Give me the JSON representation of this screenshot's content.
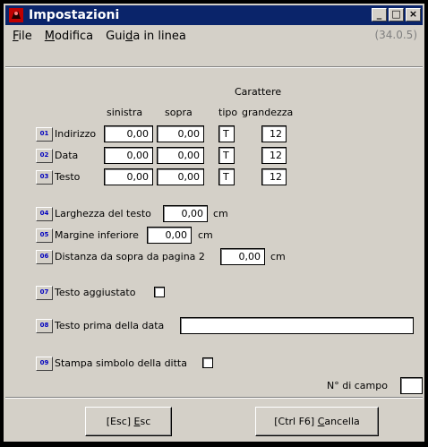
{
  "window": {
    "title": "Impostazioni",
    "controls": [
      "_",
      "□",
      "×"
    ]
  },
  "menu": {
    "file": "File",
    "file_mn": "F",
    "modifica": "Modifica",
    "modifica_mn": "M",
    "guida_pre": "Gui",
    "guida_mn": "d",
    "guida_post": "a in linea",
    "version": "(34.0.5)"
  },
  "headers": {
    "carattere": "Carattere",
    "sinistra": "sinistra",
    "sopra": "sopra",
    "tipo": "tipo",
    "grandezza": "grandezza"
  },
  "rows": [
    {
      "num": "01",
      "label": "Indirizzo",
      "sinistra": "0,00",
      "sopra": "0,00",
      "tipo": "T",
      "grandezza": "12"
    },
    {
      "num": "02",
      "label": "Data",
      "sinistra": "0,00",
      "sopra": "0,00",
      "tipo": "T",
      "grandezza": "12"
    },
    {
      "num": "03",
      "label": "Testo",
      "sinistra": "0,00",
      "sopra": "0,00",
      "tipo": "T",
      "grandezza": "12"
    }
  ],
  "options": {
    "o04": {
      "num": "04",
      "label": "Larghezza del testo",
      "value": "0,00",
      "unit": "cm"
    },
    "o05": {
      "num": "05",
      "label": "Margine inferiore",
      "value": "0,00",
      "unit": "cm"
    },
    "o06": {
      "num": "06",
      "label": "Distanza da sopra da pagina 2",
      "value": "0,00",
      "unit": "cm"
    },
    "o07": {
      "num": "07",
      "label": "Testo aggiustato"
    },
    "o08": {
      "num": "08",
      "label": "Testo prima della data",
      "value": ""
    },
    "o09": {
      "num": "09",
      "label": "Stampa simbolo della ditta"
    }
  },
  "campo": {
    "label": "N° di campo",
    "value": ""
  },
  "buttons": {
    "esc_pre": "[Esc] ",
    "esc_mn": "E",
    "esc_post": "sc",
    "canc_pre": "[Ctrl F6] ",
    "canc_mn": "C",
    "canc_post": "ancella"
  },
  "colors": {
    "titlebar": "#0a246a",
    "face": "#d4d0c8",
    "number": "#0000c0"
  }
}
